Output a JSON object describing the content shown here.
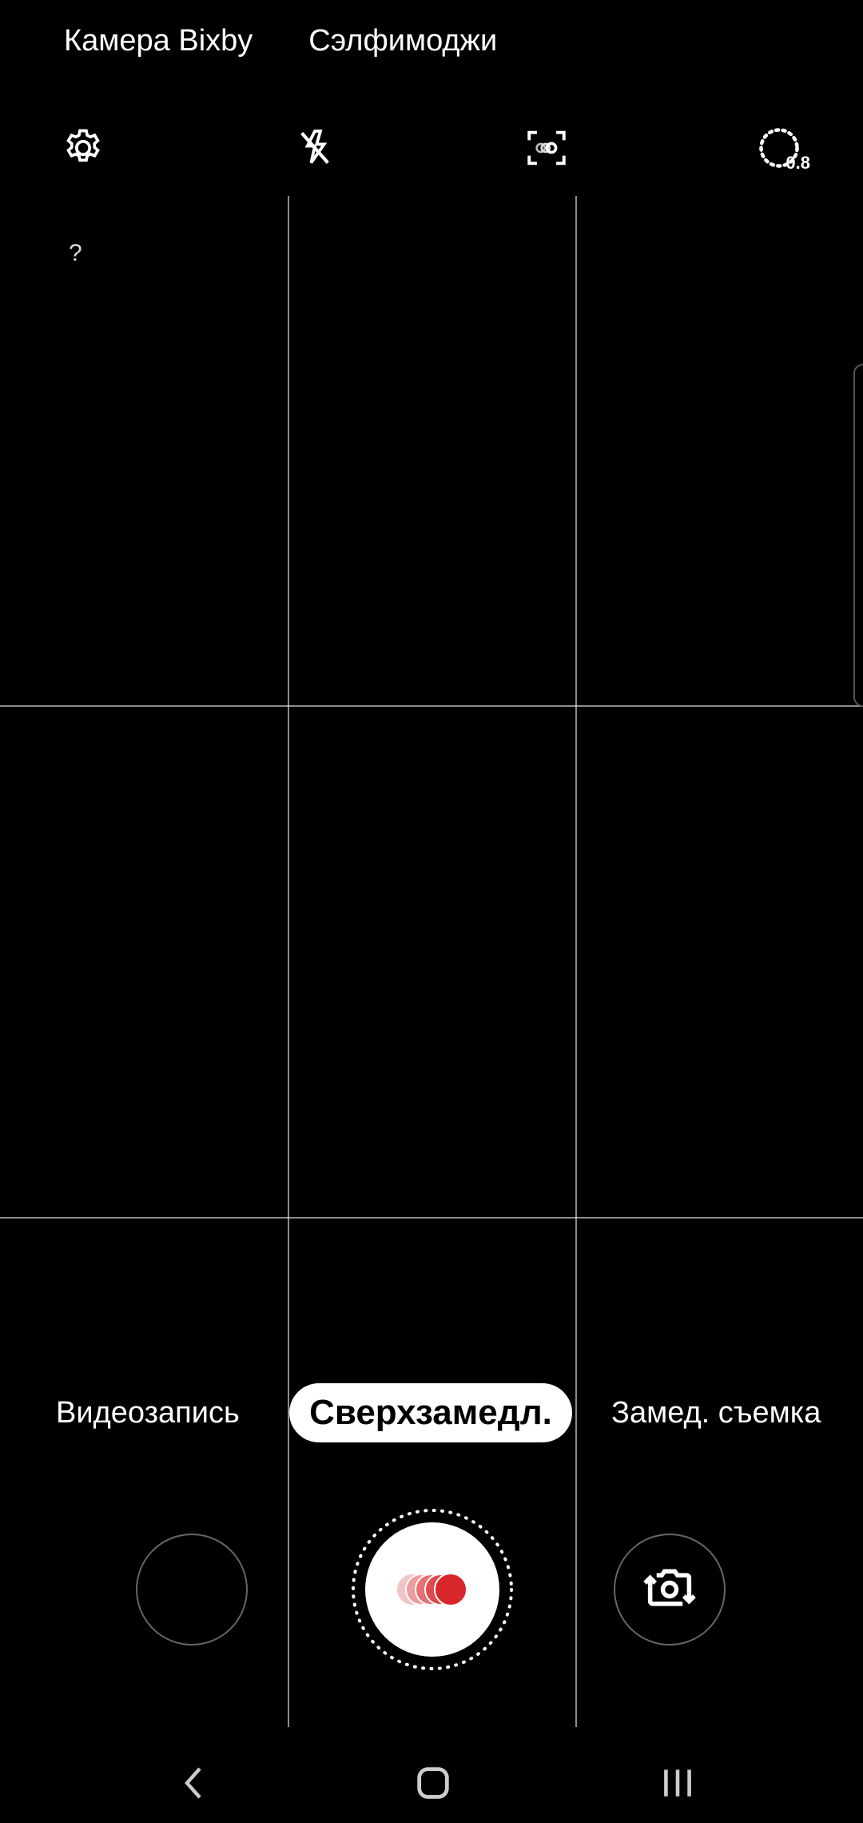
{
  "top_links": {
    "bixby": "Камера Bixby",
    "selfie_emoji": "Сэлфимоджи"
  },
  "toolbar": {
    "zoom_value": "0.8",
    "icons": [
      "gear-icon",
      "flash-off-icon",
      "focus-frame-icon",
      "zoom-dial-icon"
    ]
  },
  "help": {
    "label": "?"
  },
  "modes": {
    "video": "Видеозапись",
    "super_slow": "Сверхзамедл.",
    "slow_motion": "Замед. съемка",
    "active": "super_slow"
  },
  "colors": {
    "background": "#000000",
    "grid": "#8a8a8a",
    "record_red": "#d9262a",
    "mode_pill": "#ffffff"
  },
  "navbar": {
    "icons": [
      "back-icon",
      "home-icon",
      "recents-icon"
    ]
  }
}
